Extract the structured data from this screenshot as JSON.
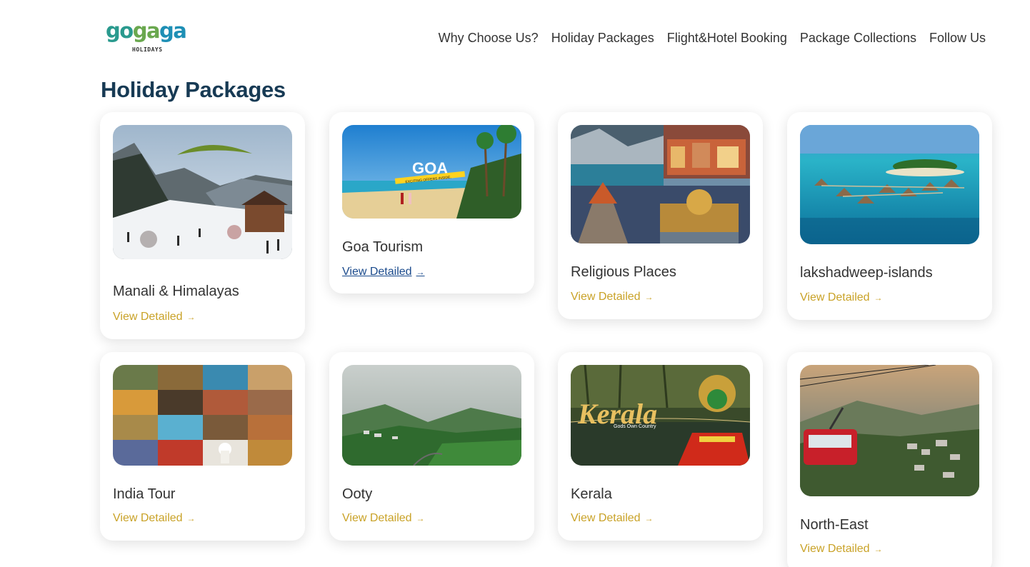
{
  "brand": {
    "logo_text_1": "go",
    "logo_text_2": "ga",
    "logo_text_3": "ga",
    "logo_sub": "HOLIDAYS"
  },
  "nav": {
    "items": [
      {
        "label": "Why Choose Us?"
      },
      {
        "label": "Holiday Packages"
      },
      {
        "label": "Flight&Hotel Booking"
      },
      {
        "label": "Package Collections"
      },
      {
        "label": "Follow Us"
      }
    ]
  },
  "page": {
    "title": "Holiday Packages"
  },
  "packages": [
    {
      "title": "Manali & Himalayas",
      "link": "View Detailed",
      "arrow": "→"
    },
    {
      "title": "Goa Tourism",
      "link": "View Detailed",
      "arrow": "→",
      "image_text": "GOA",
      "image_subtext": "EXCITING OFFERS INSIDE."
    },
    {
      "title": "Religious Places",
      "link": "View Detailed",
      "arrow": "→"
    },
    {
      "title": "lakshadweep-islands",
      "link": "View Detailed",
      "arrow": "→"
    },
    {
      "title": "India Tour",
      "link": "View Detailed",
      "arrow": "→"
    },
    {
      "title": "Ooty",
      "link": "View Detailed",
      "arrow": "→"
    },
    {
      "title": "Kerala",
      "link": "View Detailed",
      "arrow": "→",
      "image_text": "Kerala",
      "image_subtext": "Gods Own Country"
    },
    {
      "title": "North-East",
      "link": "View Detailed",
      "arrow": "→"
    }
  ],
  "colors": {
    "title": "#173a54",
    "link": "#c9a227",
    "link_active": "#1a4a8c"
  }
}
